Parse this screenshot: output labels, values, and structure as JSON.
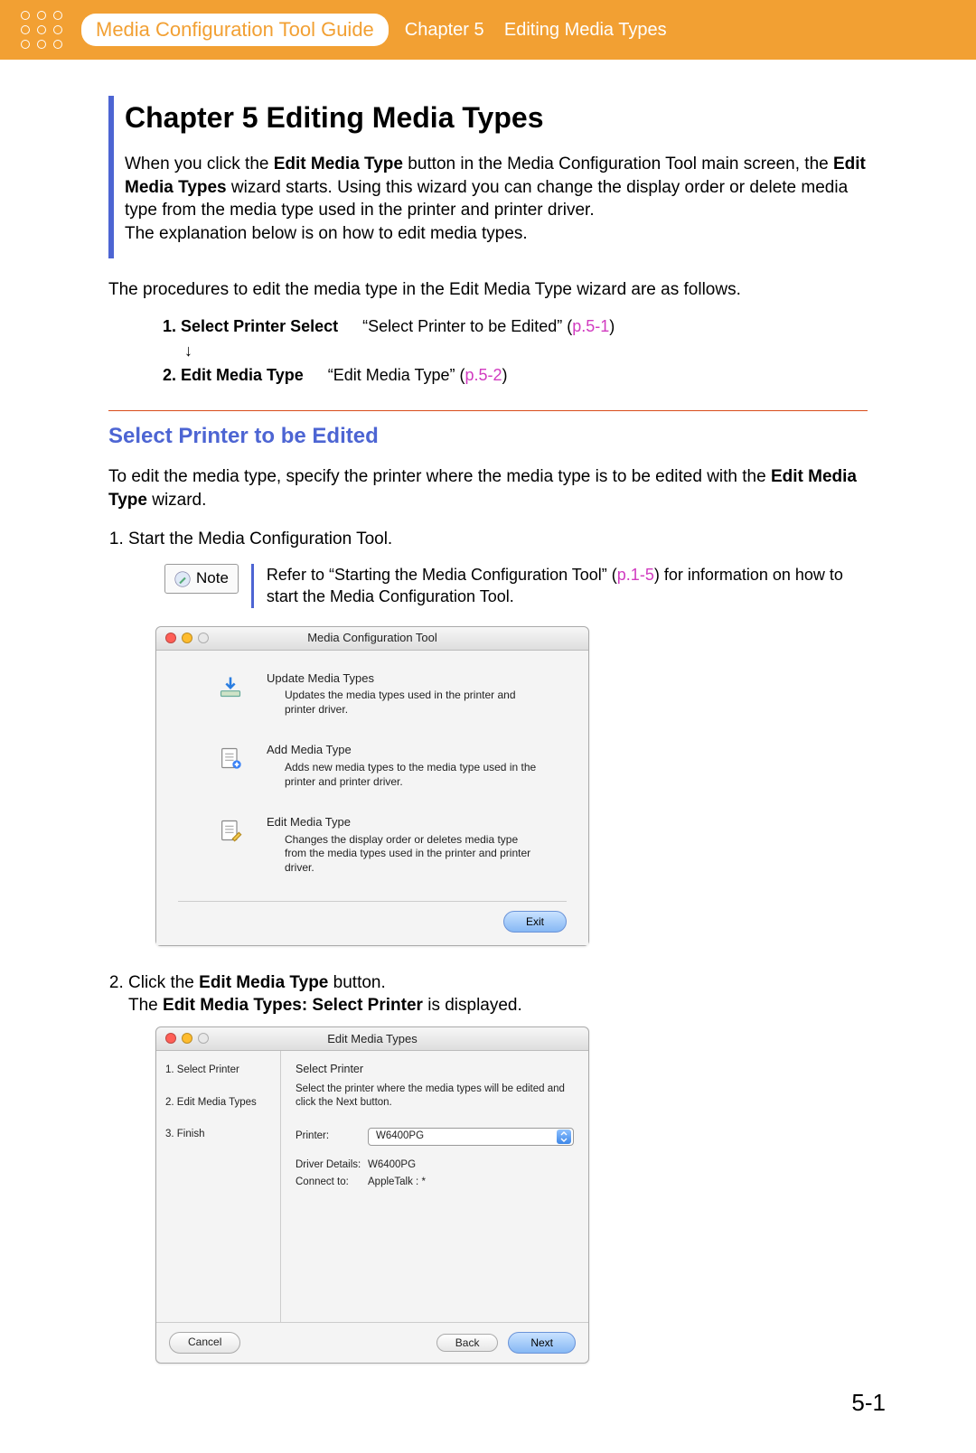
{
  "header": {
    "guide_title": "Media Configuration Tool Guide",
    "chapter_label": "Chapter 5",
    "breadcrumb": "Editing Media Types"
  },
  "chapter": {
    "title": "Chapter 5  Editing Media Types",
    "intro_parts": {
      "p1a": "When you click the ",
      "b1": "Edit Media Type",
      "p1b": " button in the Media Configuration Tool main screen, the ",
      "b2": "Edit Media Types",
      "p1c": " wizard starts. Using this wizard you can change the display order or delete media type from the media type used in the printer and printer driver.",
      "p2": "The explanation below is on how to edit media types."
    },
    "procedures_lead": "The procedures to edit the media type in the Edit Media Type wizard are as follows.",
    "proc": {
      "one_num": "1.",
      "one_bold": "Select Printer Select",
      "one_quote": "“Select Printer to be Edited” (",
      "one_link": "p.5-1",
      "close": ")",
      "arrow": "↓",
      "two_num": "2.",
      "two_bold": "Edit Media Type",
      "two_quote": "“Edit Media Type” (",
      "two_link": "p.5-2"
    }
  },
  "section": {
    "title": "Select Printer to be Edited",
    "lead_a": "To edit the media type, specify the printer where the media type is to be edited with the ",
    "lead_b": "Edit Media Type",
    "lead_c": " wizard.",
    "step1": "Start the Media Configuration Tool.",
    "note_label": "Note",
    "note_a": "Refer to “Starting the Media Configuration Tool” (",
    "note_link": "p.1-5",
    "note_b": ") for information on how to start the Media Configuration Tool.",
    "step2a": "Click the ",
    "step2b": "Edit Media Type",
    "step2c": " button.",
    "step2d_a": "The ",
    "step2d_b": "Edit Media Types: Select Printer",
    "step2d_c": " is displayed."
  },
  "win1": {
    "title": "Media Configuration Tool",
    "rows": [
      {
        "title": "Update Media Types",
        "desc": "Updates the media types used in the printer and printer driver."
      },
      {
        "title": "Add Media Type",
        "desc": "Adds new media types to the media type used in the printer and printer driver."
      },
      {
        "title": "Edit Media Type",
        "desc": "Changes the display order or deletes media type from the media types used in the printer and printer driver."
      }
    ],
    "exit": "Exit"
  },
  "win2": {
    "title": "Edit Media Types",
    "side": [
      "1. Select Printer",
      "2. Edit Media Types",
      "3. Finish"
    ],
    "header": "Select Printer",
    "instr": "Select the printer where the media types will be edited and click the Next button.",
    "printer_label": "Printer:",
    "printer_value": "W6400PG",
    "driver_label": "Driver Details:",
    "driver_value": "W6400PG",
    "connect_label": "Connect to:",
    "connect_value": "AppleTalk : *",
    "cancel": "Cancel",
    "back": "Back",
    "next": "Next"
  },
  "page_number": "5-1"
}
